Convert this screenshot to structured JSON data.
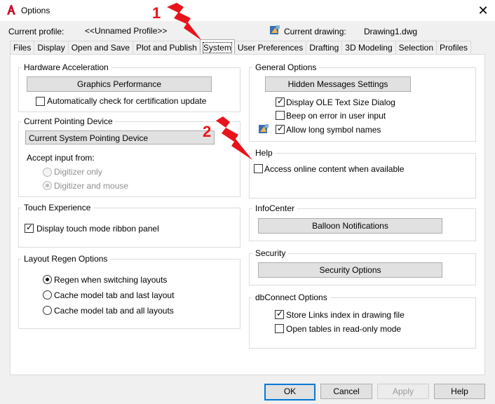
{
  "window": {
    "title": "Options",
    "app_icon": "autocad-a-icon",
    "close_icon": "close-icon"
  },
  "header": {
    "profile_label": "Current profile:",
    "profile_value": "<<Unnamed Profile>>",
    "drawing_label": "Current drawing:",
    "drawing_value": "Drawing1.dwg",
    "drawing_icon": "drawing-file-icon"
  },
  "tabs": [
    {
      "label": "Files"
    },
    {
      "label": "Display"
    },
    {
      "label": "Open and Save"
    },
    {
      "label": "Plot and Publish"
    },
    {
      "label": "System",
      "active": true
    },
    {
      "label": "User Preferences"
    },
    {
      "label": "Drafting"
    },
    {
      "label": "3D Modeling"
    },
    {
      "label": "Selection"
    },
    {
      "label": "Profiles"
    }
  ],
  "hardware": {
    "title": "Hardware Acceleration",
    "button": "Graphics Performance",
    "auto_check_label": "Automatically check for certification update",
    "auto_check_checked": false
  },
  "pointing": {
    "title": "Current Pointing Device",
    "selected": "Current System Pointing Device",
    "accept_label": "Accept input from:",
    "radio_digitizer_only": "Digitizer only",
    "radio_digitizer_mouse": "Digitizer and mouse",
    "selected_radio": "Digitizer and mouse"
  },
  "touch": {
    "title": "Touch Experience",
    "ribbon_label": "Display touch mode ribbon panel",
    "ribbon_checked": true
  },
  "layout_regen": {
    "title": "Layout Regen Options",
    "options": [
      "Regen when switching layouts",
      "Cache model tab and last layout",
      "Cache model tab and all layouts"
    ],
    "selected": "Regen when switching layouts"
  },
  "general": {
    "title": "General Options",
    "button": "Hidden Messages Settings",
    "ole_label": "Display OLE Text Size Dialog",
    "ole_checked": true,
    "beep_label": "Beep on error in user input",
    "beep_checked": false,
    "long_names_label": "Allow long symbol names",
    "long_names_checked": true
  },
  "help": {
    "title": "Help",
    "online_label": "Access online content when available",
    "online_checked": false
  },
  "infocenter": {
    "title": "InfoCenter",
    "button": "Balloon Notifications"
  },
  "security": {
    "title": "Security",
    "button": "Security Options"
  },
  "dbconnect": {
    "title": "dbConnect Options",
    "store_links_label": "Store Links index in drawing file",
    "store_links_checked": true,
    "read_only_label": "Open tables in read-only mode",
    "read_only_checked": false
  },
  "footer": {
    "ok": "OK",
    "cancel": "Cancel",
    "apply": "Apply",
    "help": "Help"
  },
  "annotations": {
    "marker1": "1",
    "marker2": "2",
    "color": "#e8141b"
  }
}
